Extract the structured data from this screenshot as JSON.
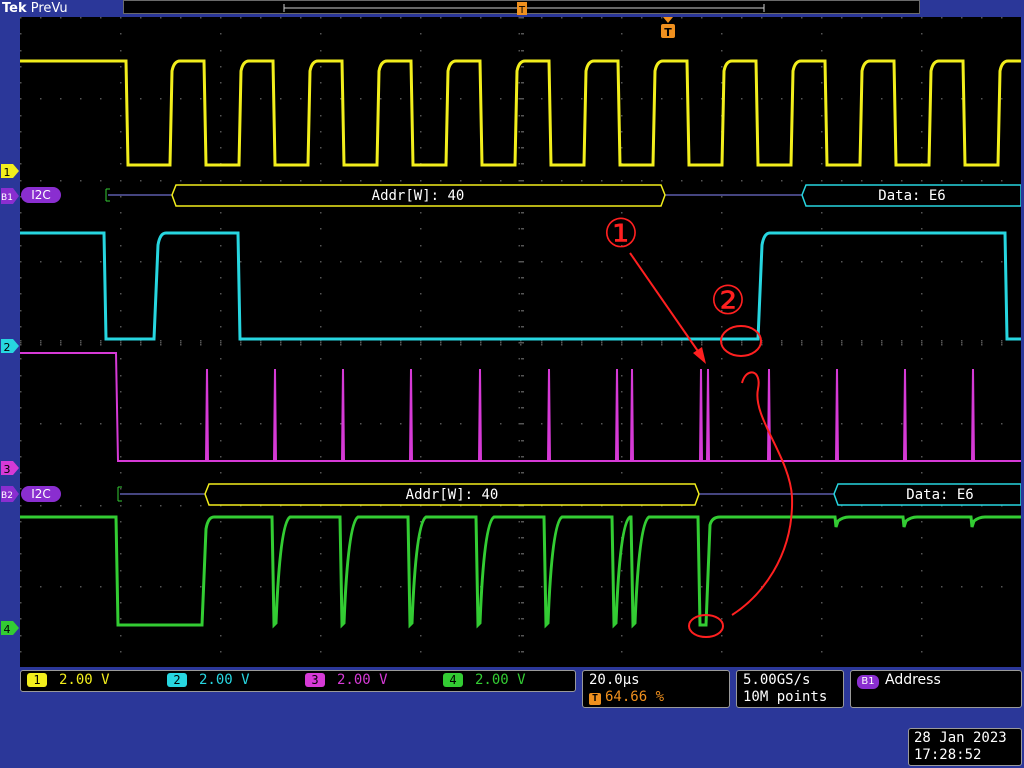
{
  "brand": {
    "maker": "Tek",
    "mode": "PreVu"
  },
  "markers": {
    "trigger": "T",
    "ch1": "1",
    "ch2": "2",
    "ch3": "3",
    "ch4": "4",
    "b1": "B1",
    "b2": "B2"
  },
  "bus1": {
    "label": "I2C",
    "addr": "Addr[W]: 40",
    "data": "Data: E6"
  },
  "bus2": {
    "label": "I2C",
    "addr": "Addr[W]: 40",
    "data": "Data: E6"
  },
  "annotations": {
    "first": "①",
    "second": "②"
  },
  "channels": [
    {
      "num": "1",
      "scale": "2.00 V",
      "color": "#f2ee1c"
    },
    {
      "num": "2",
      "scale": "2.00 V",
      "color": "#27d6e0"
    },
    {
      "num": "3",
      "scale": "2.00 V",
      "color": "#d63ad6"
    },
    {
      "num": "4",
      "scale": "2.00 V",
      "color": "#33cc33"
    }
  ],
  "timebase": {
    "per_div": "20.0µs",
    "trigger_pos": "64.66 %"
  },
  "acquisition": {
    "rate": "5.00GS/s",
    "points": "10M points"
  },
  "trigger_src": {
    "bus": "B1",
    "type": "Address"
  },
  "datetime": {
    "date": "28 Jan  2023",
    "time": "17:28:52"
  },
  "colors": {
    "ch1": "#f2ee1c",
    "ch2": "#27d6e0",
    "ch3": "#d63ad6",
    "ch4": "#33cc33",
    "annot": "#ff2020",
    "bus": "#8a2ed0"
  }
}
